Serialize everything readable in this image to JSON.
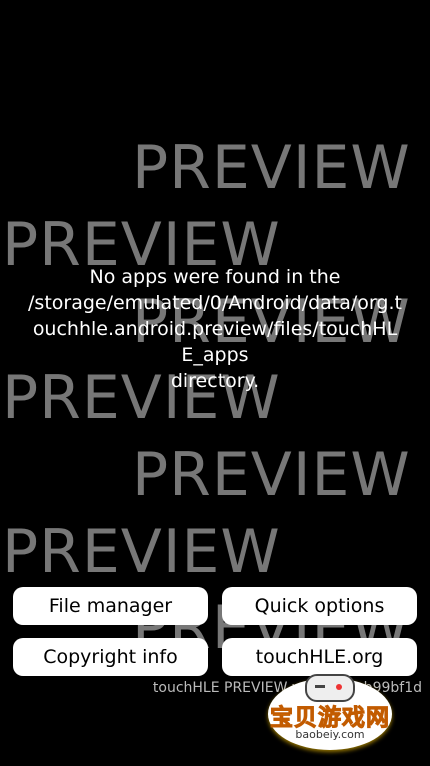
{
  "watermark": {
    "text": "PREVIEW",
    "color": "#777777"
  },
  "message": {
    "line1": "No apps were found in the",
    "line2": "/storage/emulated/0/Android/data/org.t",
    "line3": "ouchhle.android.preview/files/touchHL",
    "line4": "E_apps",
    "line5": "directory."
  },
  "buttons": {
    "file_manager": "File manager",
    "quick_options": "Quick options",
    "copyright_info": "Copyright info",
    "website": "touchHLE.org"
  },
  "version_text": "touchHLE PREVIEW v0.2.2-9-gb99bf1d",
  "overlay_logo": {
    "title": "宝贝游戏网",
    "url": "baobeiy.com",
    "icon": "gamepad-icon"
  },
  "colors": {
    "background": "#000000",
    "button_bg": "#ffffff",
    "text": "#ffffff",
    "logo_orange": "#ff9900"
  }
}
